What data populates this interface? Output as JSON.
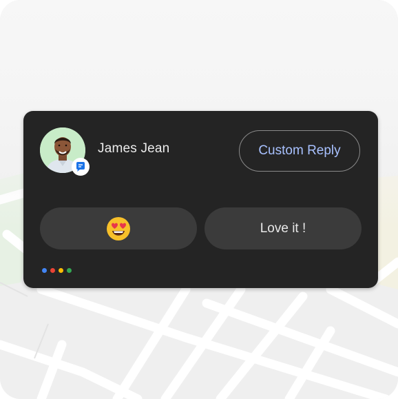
{
  "contact": {
    "name": "James Jean",
    "avatar": "avatar-photo",
    "badge": "messages-icon"
  },
  "actions": {
    "custom_reply_label": "Custom Reply",
    "quick_replies": [
      {
        "emoji": "smiling-face-with-heart-eyes",
        "label": "😍"
      },
      {
        "label": "Love it !"
      }
    ]
  },
  "assistant_dots": [
    "#4285F4",
    "#EA4335",
    "#FBBC05",
    "#34A853"
  ],
  "colors": {
    "card_bg": "#242424",
    "button_bg": "#3b3b3b",
    "accent_text": "#a8c1ff",
    "avatar_bg": "#c8ecc8"
  }
}
